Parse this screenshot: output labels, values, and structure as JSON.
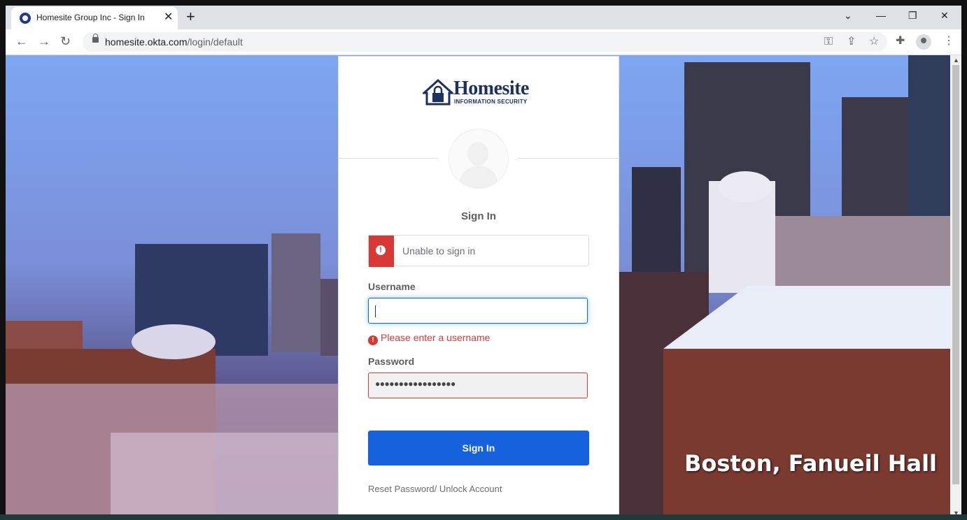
{
  "browser": {
    "tab_title": "Homesite Group Inc - Sign In",
    "tab_close": "✕",
    "new_tab": "+",
    "url_host": "homesite.okta.com",
    "url_path": "/login/default",
    "window_controls": {
      "chevron": "⌄",
      "minimize": "—",
      "restore": "❐",
      "close": "✕"
    }
  },
  "logo": {
    "word": "Homesite",
    "tagline": "INFORMATION SECURITY",
    "brand_color": "#1c3161"
  },
  "form": {
    "title": "Sign In",
    "error_banner": "Unable to sign in",
    "error_icon": "!",
    "username_label": "Username",
    "username_value": "",
    "username_error": "Please enter a username",
    "password_label": "Password",
    "password_value": "●●●●●●●●●●●●●●●●●",
    "submit_label": "Sign In",
    "reset_link": "Reset Password/ Unlock Account"
  },
  "background": {
    "caption": "Boston, Fanueil Hall"
  },
  "colors": {
    "primary": "#1662dd",
    "error": "#d93934"
  }
}
